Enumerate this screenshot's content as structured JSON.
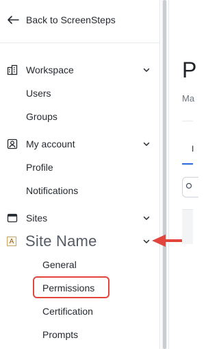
{
  "sidebar": {
    "back_label": "Back to ScreenSteps",
    "sections": {
      "workspace": {
        "label": "Workspace",
        "items": [
          "Users",
          "Groups"
        ]
      },
      "my_account": {
        "label": "My account",
        "items": [
          "Profile",
          "Notifications"
        ]
      },
      "sites": {
        "label": "Sites"
      }
    },
    "site": {
      "badge": "A",
      "name": "Site Name",
      "items": [
        "General",
        "Permissions",
        "Certification",
        "Prompts"
      ]
    }
  },
  "main": {
    "title_partial": "P",
    "subtitle_partial": "Ma",
    "tab_partial": "I"
  },
  "colors": {
    "annotation_red": "#e2453b",
    "tab_accent": "#2f6fe4"
  }
}
